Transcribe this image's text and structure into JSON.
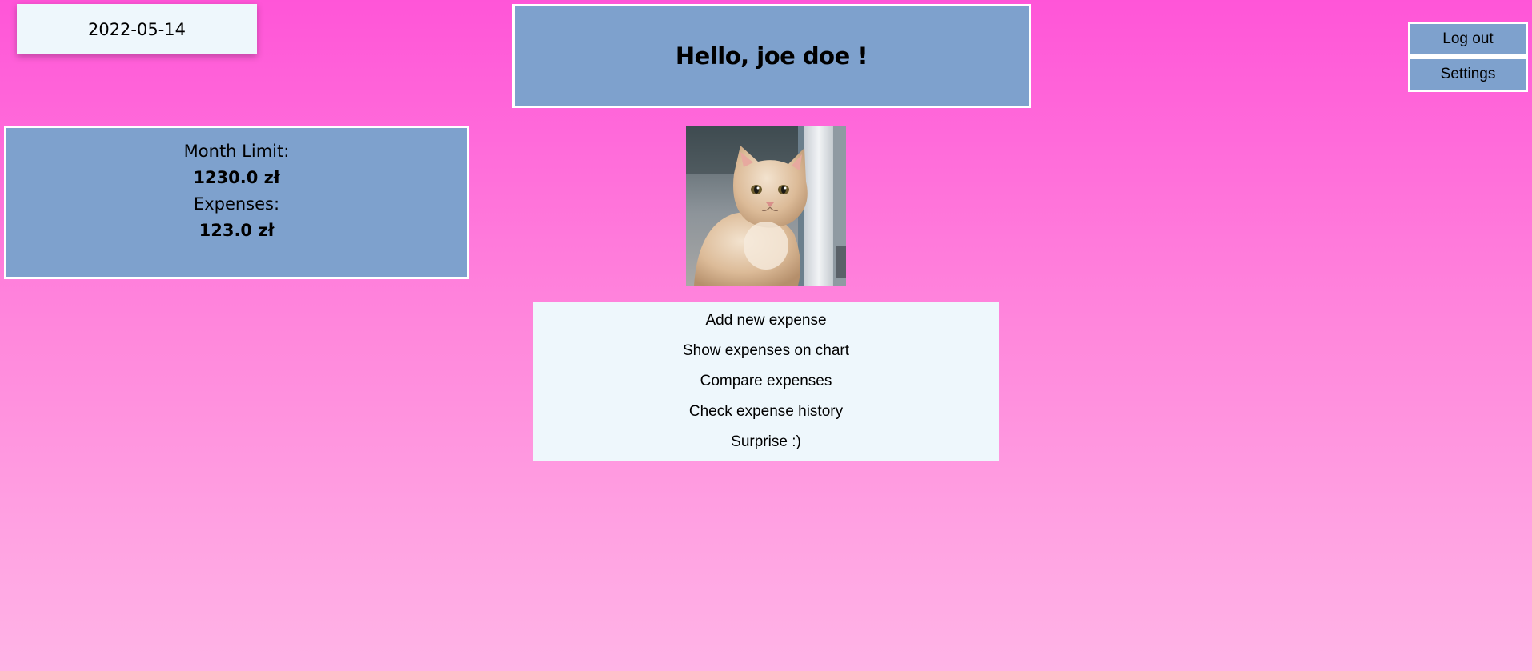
{
  "date": "2022-05-14",
  "greeting": "Hello, joe doe !",
  "auth": {
    "logout_label": "Log out",
    "settings_label": "Settings"
  },
  "budget": {
    "limit_label": "Month Limit:",
    "limit_value": "1230.0 zł",
    "expenses_label": "Expenses:",
    "expenses_value": "123.0 zł"
  },
  "photo": {
    "alt": "kitten"
  },
  "menu": {
    "items": [
      {
        "label": "Add new expense"
      },
      {
        "label": "Show expenses on chart"
      },
      {
        "label": "Compare expenses"
      },
      {
        "label": "Check expense history"
      },
      {
        "label": "Surprise :)"
      }
    ]
  },
  "colors": {
    "panel": "#7ea1cd",
    "light_panel": "#eef7fc",
    "background_top": "#ff55d8",
    "background_bottom": "#ffb4e6"
  }
}
